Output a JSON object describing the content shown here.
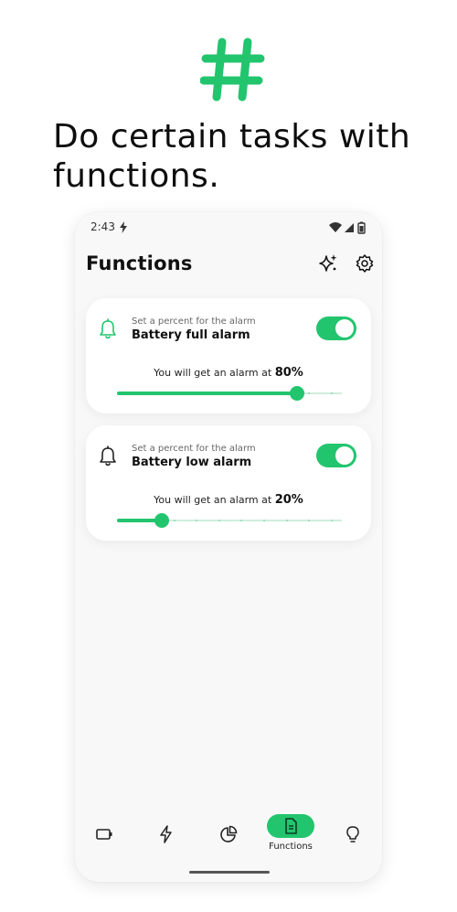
{
  "hero": {
    "icon": "hash-icon",
    "headline": "Do certain tasks with functions."
  },
  "status_bar": {
    "time": "2:43",
    "icons": [
      "bolt-icon",
      "wifi-icon",
      "signal-icon",
      "battery-icon"
    ]
  },
  "app": {
    "title": "Functions",
    "actions": [
      "sparkle-icon",
      "gear-icon"
    ]
  },
  "cards": [
    {
      "hint": "Set a percent for the alarm",
      "title": "Battery full alarm",
      "enabled": true,
      "icon": "bell-icon",
      "alarm_text": "You will get an alarm at",
      "percent_label": "80%",
      "percent": 80
    },
    {
      "hint": "Set a percent for the alarm",
      "title": "Battery low alarm",
      "enabled": true,
      "icon": "bell-icon",
      "alarm_text": "You will get an alarm at",
      "percent_label": "20%",
      "percent": 20
    }
  ],
  "bottom_nav": {
    "items": [
      {
        "icon": "battery-outline-icon"
      },
      {
        "icon": "lightning-icon"
      },
      {
        "icon": "pie-chart-icon"
      },
      {
        "icon": "document-icon",
        "label": "Functions",
        "active": true
      },
      {
        "icon": "lightbulb-icon"
      }
    ]
  },
  "colors": {
    "accent": "#22c56e",
    "track": "#cfeedd",
    "background": "#f8f8f8",
    "card": "#ffffff"
  }
}
